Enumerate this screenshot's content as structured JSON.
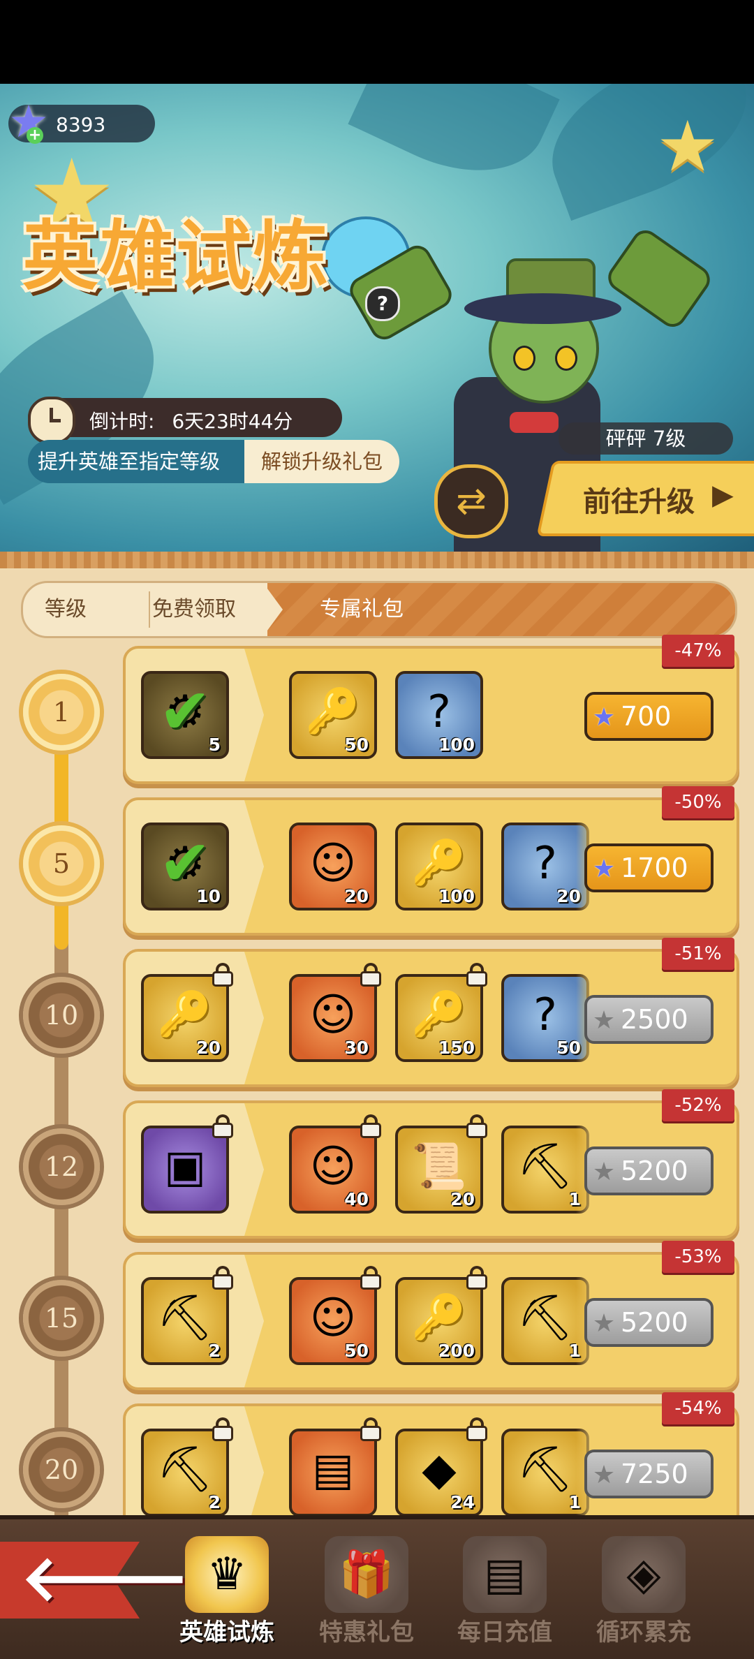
{
  "header": {
    "currency": {
      "icon": "star-gem-icon",
      "value": "8393"
    },
    "title": "英雄试炼",
    "countdown": {
      "label": "倒计时:",
      "value": "6天23时44分"
    },
    "hint": {
      "left": "提升英雄至指定等级",
      "right": "解锁升级礼包"
    },
    "hero": {
      "name_level": "砰砰  7级"
    },
    "goto_button": "前往升级"
  },
  "tabs": {
    "items": [
      {
        "label": "等级"
      },
      {
        "label": "免费领取"
      },
      {
        "label": "专属礼包"
      }
    ],
    "active": "专属礼包"
  },
  "rows": [
    {
      "level": "1",
      "discount": "-47%",
      "price": "700",
      "purchasable": true,
      "free": {
        "icon": "gear-key-icon",
        "qty": "5",
        "claimed": true,
        "locked": false
      },
      "items": [
        {
          "icon": "wind-up-key-icon",
          "qty": "50",
          "bg": "gold",
          "locked": false
        },
        {
          "icon": "mystery-stone-icon",
          "qty": "100",
          "bg": "blue",
          "locked": false
        }
      ]
    },
    {
      "level": "5",
      "discount": "-50%",
      "price": "1700",
      "purchasable": true,
      "free": {
        "icon": "gear-key-icon",
        "qty": "10",
        "claimed": true,
        "locked": false
      },
      "items": [
        {
          "icon": "hero-shard-icon",
          "qty": "20",
          "bg": "orange",
          "locked": false
        },
        {
          "icon": "wind-up-key-icon",
          "qty": "100",
          "bg": "gold",
          "locked": false
        },
        {
          "icon": "mystery-stone-icon",
          "qty": "20",
          "bg": "blue",
          "locked": false
        }
      ]
    },
    {
      "level": "10",
      "discount": "-51%",
      "price": "2500",
      "purchasable": false,
      "free": {
        "icon": "wind-up-key-icon",
        "qty": "20",
        "claimed": false,
        "locked": true
      },
      "items": [
        {
          "icon": "hero-shard-icon",
          "qty": "30",
          "bg": "orange",
          "locked": true
        },
        {
          "icon": "wind-up-key-icon",
          "qty": "150",
          "bg": "gold",
          "locked": true
        },
        {
          "icon": "mystery-stone-icon",
          "qty": "50",
          "bg": "blue",
          "locked": false
        }
      ]
    },
    {
      "level": "12",
      "discount": "-52%",
      "price": "5200",
      "purchasable": false,
      "free": {
        "icon": "mystery-chest-icon",
        "qty": "",
        "claimed": false,
        "locked": true
      },
      "items": [
        {
          "icon": "hero-shard-icon",
          "qty": "40",
          "bg": "orange",
          "locked": true
        },
        {
          "icon": "scroll-icon",
          "qty": "20",
          "bg": "gold",
          "locked": true
        },
        {
          "icon": "pickaxe-icon",
          "qty": "1",
          "bg": "gold",
          "locked": false
        }
      ]
    },
    {
      "level": "15",
      "discount": "-53%",
      "price": "5200",
      "purchasable": false,
      "free": {
        "icon": "pickaxe-icon",
        "qty": "2",
        "claimed": false,
        "locked": true
      },
      "items": [
        {
          "icon": "hero-shard-icon",
          "qty": "50",
          "bg": "orange",
          "locked": true
        },
        {
          "icon": "wind-up-key-icon",
          "qty": "200",
          "bg": "gold",
          "locked": true
        },
        {
          "icon": "pickaxe-icon",
          "qty": "1",
          "bg": "gold",
          "locked": false
        }
      ]
    },
    {
      "level": "20",
      "discount": "-54%",
      "price": "7250",
      "purchasable": false,
      "free": {
        "icon": "pickaxe-icon",
        "qty": "2",
        "claimed": false,
        "locked": true
      },
      "items": [
        {
          "icon": "treasure-chest-icon",
          "qty": "",
          "bg": "orange",
          "locked": true
        },
        {
          "icon": "gold-ore-icon",
          "qty": "24",
          "bg": "gold",
          "locked": true
        },
        {
          "icon": "pickaxe-icon",
          "qty": "1",
          "bg": "gold",
          "locked": false
        }
      ]
    }
  ],
  "bottom_nav": {
    "back_icon": "back-arrow-icon",
    "items": [
      {
        "label": "英雄试炼",
        "icon": "hero-trial-icon",
        "active": true
      },
      {
        "label": "特惠礼包",
        "icon": "gift-pack-icon",
        "active": false
      },
      {
        "label": "每日充值",
        "icon": "daily-recharge-icon",
        "active": false
      },
      {
        "label": "循环累充",
        "icon": "cycle-recharge-icon",
        "active": false
      }
    ]
  },
  "colors": {
    "accent_gold": "#f2b627",
    "discount_red": "#c53434",
    "price_buy": "#e5951a",
    "price_locked": "#9d9d9d",
    "panel_bg": "#efd9b0"
  }
}
